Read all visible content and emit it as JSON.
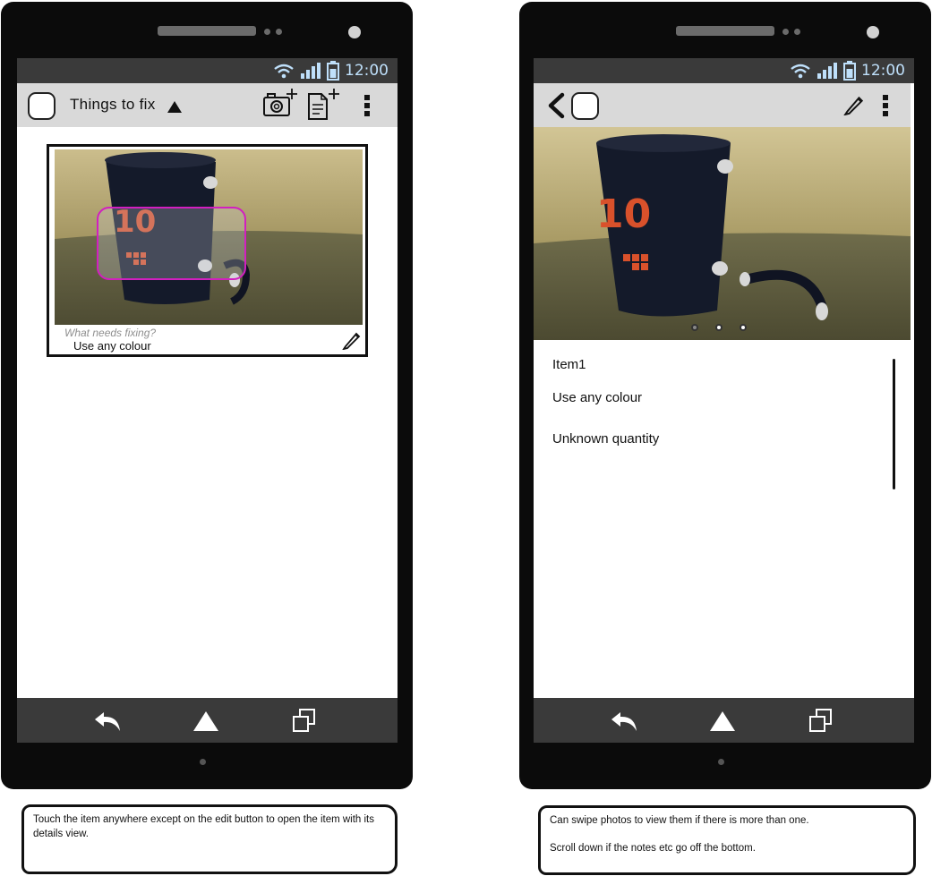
{
  "status": {
    "time": "12:00"
  },
  "left_screen": {
    "title": "Things to fix",
    "card": {
      "placeholder": "What needs fixing?",
      "value": "Use any colour"
    }
  },
  "right_screen": {
    "item_title": "Item1",
    "notes": [
      "Use any colour",
      "Unknown quantity"
    ],
    "photo_pages": 3,
    "active_page": 1
  },
  "annotations": {
    "left": "Touch the item anywhere except on the edit button to open the item with its details view.",
    "right_line1": "Can swipe photos to view them if there is more than one.",
    "right_line2": "Scroll down if the notes etc go off the bottom."
  },
  "colors": {
    "device": "#0b0b0b",
    "status_bar": "#3a3a3a",
    "action_bar": "#d9d9d9",
    "highlight": "#d21fc0",
    "status_icons": "#8fc6f2"
  },
  "icons": [
    "wifi-icon",
    "signal-icon",
    "battery-icon",
    "app-icon",
    "add-photo-icon",
    "add-note-icon",
    "overflow-menu-icon",
    "back-arrow-icon",
    "edit-pencil-icon",
    "nav-back-icon",
    "nav-home-icon",
    "nav-recents-icon"
  ]
}
